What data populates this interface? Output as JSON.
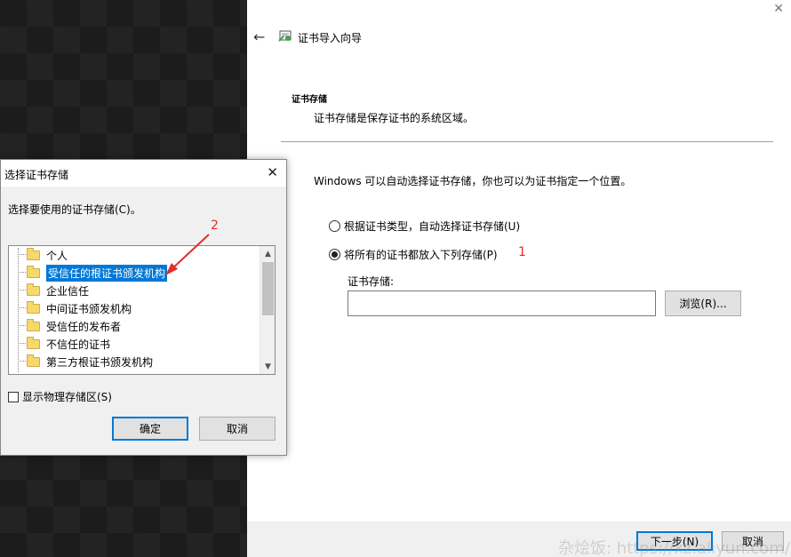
{
  "wizard": {
    "close_glyph": "✕",
    "back_glyph": "←",
    "title": "证书导入向导",
    "section_title": "证书存储",
    "section_desc": "证书存储是保存证书的系统区域。",
    "info_text": "Windows 可以自动选择证书存储，你也可以为证书指定一个位置。",
    "radio_auto": "根据证书类型，自动选择证书存储(U)",
    "radio_manual": "将所有的证书都放入下列存储(P)",
    "selected_option": "manual",
    "store_label": "证书存储:",
    "store_value": "",
    "browse_label": "浏览(R)...",
    "next_label": "下一步(N)",
    "cancel_label": "取消",
    "watermark": "杂烩饭: https://xz.aliyun.com/u/ran"
  },
  "dialog": {
    "title": "选择证书存储",
    "close_glyph": "✕",
    "prompt": "选择要使用的证书存储(C)。",
    "stores": [
      "个人",
      "受信任的根证书颁发机构",
      "企业信任",
      "中间证书颁发机构",
      "受信任的发布者",
      "不信任的证书",
      "第三方根证书颁发机构"
    ],
    "selected_store": "受信任的根证书颁发机构",
    "show_physical_label": "显示物理存储区(S)",
    "show_physical_checked": false,
    "ok_label": "确定",
    "cancel_label": "取消",
    "scroll_up_glyph": "▲",
    "scroll_down_glyph": "▼"
  },
  "annotations": {
    "step1": "1",
    "step2": "2",
    "color": "#e0302a"
  },
  "colors": {
    "accent": "#0078d7",
    "folder": "#f5d96b"
  }
}
